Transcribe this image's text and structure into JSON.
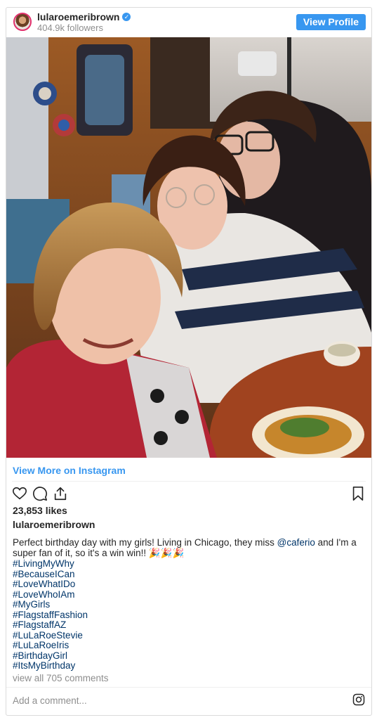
{
  "post": {
    "username": "lularoemeribrown",
    "followers": "404.9k followers",
    "view_profile_label": "View Profile",
    "view_more_label": "View More on Instagram",
    "likes": "23,853 likes",
    "owner": "lularoemeribrown",
    "caption_text": "Perfect birthday day with my girls! Living in Chicago, they miss ",
    "caption_mention": "@caferio",
    "caption_text2": " and I'm a super fan of it, so it's a win win!! 🎉🎉🎉",
    "hashtags": [
      "#LivingMyWhy",
      "#BecauseICan",
      "#LoveWhatIDo",
      "#LoveWhoIAm",
      "#MyGirls",
      "#FlagstaffFashion",
      "#FlagstaffAZ",
      "#LuLaRoeStevie",
      "#LuLaRoeIris",
      "#BirthdayGirl",
      "#ItsMyBirthday"
    ],
    "view_all_comments": "view all 705 comments",
    "add_comment_placeholder": "Add a comment..."
  },
  "icons": {
    "verified": "verified-badge-icon",
    "like": "heart-icon",
    "comment": "comment-icon",
    "share": "share-icon",
    "save": "bookmark-icon",
    "instagram": "instagram-icon"
  },
  "colors": {
    "accent_blue": "#3897f0",
    "link_dark_blue": "#003569",
    "muted_gray": "#8e8e8e"
  }
}
